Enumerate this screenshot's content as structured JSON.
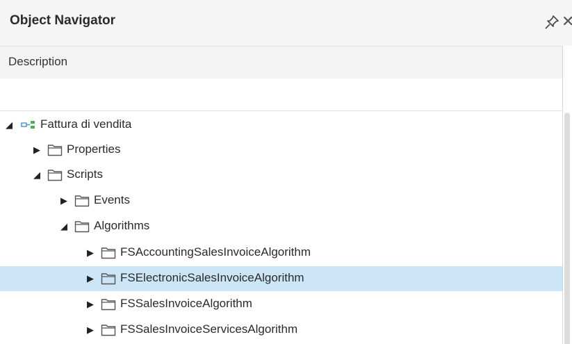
{
  "panel": {
    "title": "Object Navigator",
    "column_header": "Description",
    "filter_value": ""
  },
  "icons": {
    "pin": "pin-icon",
    "close": "close-icon",
    "expanded": "triangle-expanded-icon",
    "collapsed": "triangle-collapsed-icon",
    "folder": "folder-icon",
    "root": "document-type-icon"
  },
  "colors": {
    "selected_bg": "#cde6f7",
    "header_bg": "#f5f5f5"
  },
  "glyphs": {
    "close": "✕",
    "expanded": "◢",
    "collapsed": "▶"
  },
  "tree": {
    "items": [
      {
        "label": "Fattura di vendita",
        "expanded": true,
        "selected": false
      },
      {
        "label": "Properties",
        "expanded": false,
        "selected": false
      },
      {
        "label": "Scripts",
        "expanded": true,
        "selected": false
      },
      {
        "label": "Events",
        "expanded": false,
        "selected": false
      },
      {
        "label": "Algorithms",
        "expanded": true,
        "selected": false
      },
      {
        "label": "FSAccountingSalesInvoiceAlgorithm",
        "expanded": false,
        "selected": false
      },
      {
        "label": "FSElectronicSalesInvoiceAlgorithm",
        "expanded": false,
        "selected": true
      },
      {
        "label": "FSSalesInvoiceAlgorithm",
        "expanded": false,
        "selected": false
      },
      {
        "label": "FSSalesInvoiceServicesAlgorithm",
        "expanded": false,
        "selected": false
      }
    ]
  }
}
